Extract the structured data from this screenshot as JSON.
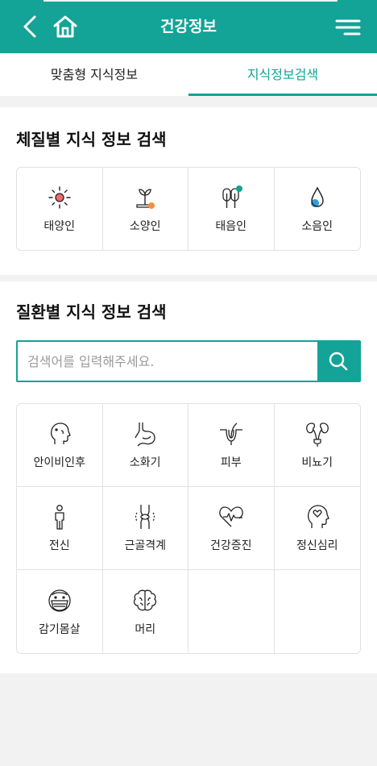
{
  "header": {
    "title": "건강정보",
    "back_icon": "back-arrow-icon",
    "home_icon": "home-icon",
    "menu_icon": "hamburger-menu-icon",
    "color": "#13a397"
  },
  "tabs": [
    {
      "label": "맞춤형 지식정보",
      "active": false
    },
    {
      "label": "지식정보검색",
      "active": true
    }
  ],
  "constitution": {
    "title": "체질별 지식 정보 검색",
    "items": [
      {
        "label": "태양인",
        "icon": "sun-icon"
      },
      {
        "label": "소양인",
        "icon": "sprout-icon"
      },
      {
        "label": "태음인",
        "icon": "tree-icon"
      },
      {
        "label": "소음인",
        "icon": "water-drop-icon"
      }
    ]
  },
  "disease": {
    "title": "질환별 지식 정보 검색",
    "search": {
      "placeholder": "검색어를 입력해주세요.",
      "value": "",
      "icon": "search-icon"
    },
    "items": [
      {
        "label": "안이비인후",
        "icon": "head-profile-icon"
      },
      {
        "label": "소화기",
        "icon": "stomach-icon"
      },
      {
        "label": "피부",
        "icon": "skin-hair-icon"
      },
      {
        "label": "비뇨기",
        "icon": "kidney-icon"
      },
      {
        "label": "전신",
        "icon": "body-icon"
      },
      {
        "label": "근골격계",
        "icon": "joint-icon"
      },
      {
        "label": "건강증진",
        "icon": "heart-pulse-icon"
      },
      {
        "label": "정신심리",
        "icon": "mind-head-icon"
      },
      {
        "label": "감기몸살",
        "icon": "mask-face-icon"
      },
      {
        "label": "머리",
        "icon": "brain-icon"
      }
    ]
  }
}
